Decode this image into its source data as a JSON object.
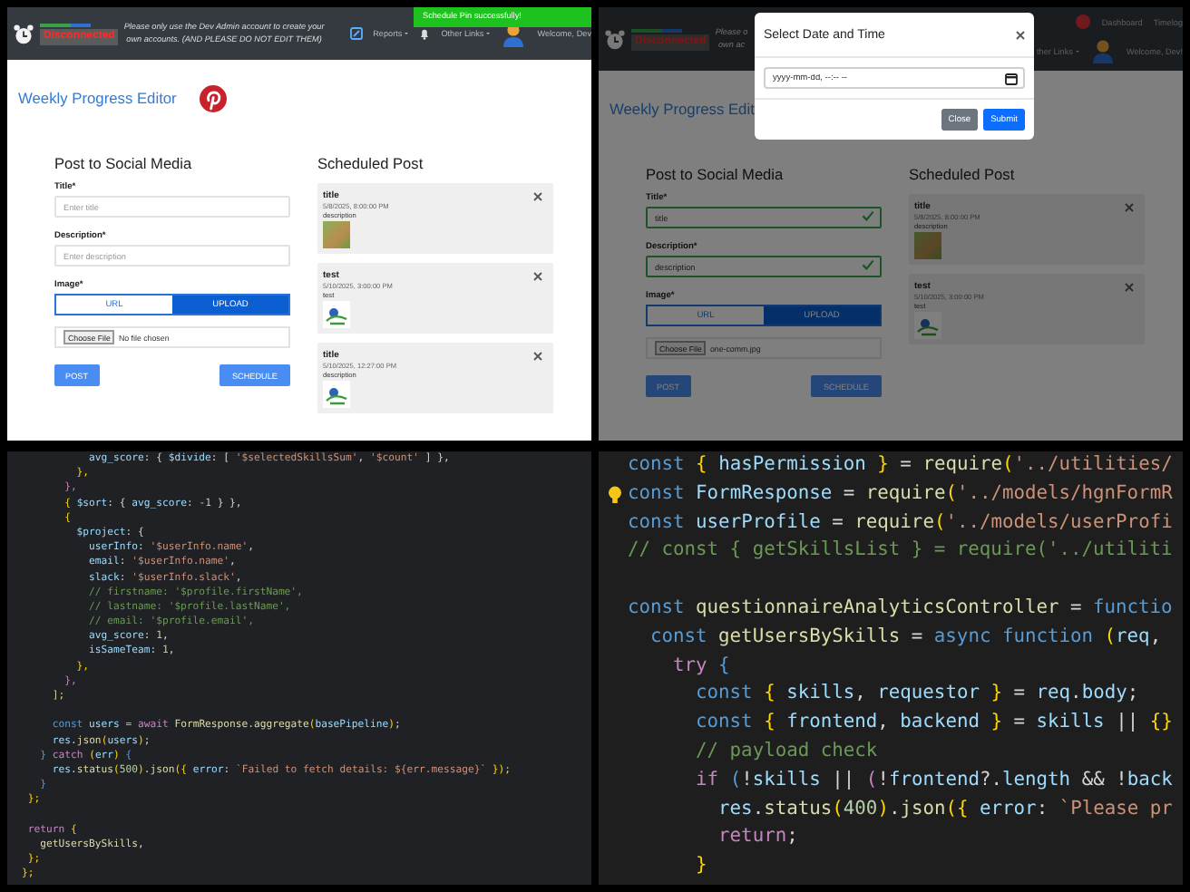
{
  "panels": [
    {
      "kind": "app",
      "header": {
        "status": "Disconnected",
        "message_lines": [
          "Please only use the Dev Admin account to create your",
          "own accounts. (AND PLEASE DO NOT EDIT THEM)"
        ],
        "toast": "Schedule Pin successfully!",
        "nav_rows": [
          [
            {
              "kind": "edit"
            },
            {
              "kind": "dropdown",
              "label": "Reports"
            },
            {
              "kind": "bell"
            },
            {
              "kind": "dropdown",
              "label": "Other Links"
            },
            {
              "kind": "avatar"
            },
            {
              "kind": "text",
              "label": "Welcome, Dev"
            }
          ]
        ]
      },
      "page_title": "Weekly Progress Editor",
      "title_icons": [
        {
          "kind": "pinterest"
        }
      ],
      "form": {
        "heading": "Post to Social Media",
        "fields": [
          {
            "label": "Title*",
            "placeholder": "Enter title",
            "valid": false
          },
          {
            "label": "Description*",
            "placeholder": "Enter description",
            "valid": false
          }
        ],
        "image": {
          "label": "Image*",
          "options": [
            {
              "label": "URL",
              "selected": false
            },
            {
              "label": "UPLOAD",
              "selected": true
            }
          ]
        },
        "file": {
          "button": "Choose File",
          "status": "No file chosen"
        },
        "buttons": [
          "POST",
          "SCHEDULE"
        ]
      },
      "scheduled": {
        "heading": "Scheduled Post",
        "posts": [
          {
            "title": "title",
            "time": "5/8/2025, 8:00:00 PM",
            "description": "description",
            "thumbnail": {
              "kind": "photo"
            }
          },
          {
            "title": "test",
            "time": "5/10/2025, 3:00:00 PM",
            "description": "test",
            "thumbnail": {
              "kind": "logo"
            }
          },
          {
            "title": "title",
            "time": "5/10/2025, 12:27:00 PM",
            "description": "description",
            "thumbnail": {
              "kind": "logo"
            }
          }
        ]
      }
    },
    {
      "kind": "app",
      "header": {
        "status": "Disconnected",
        "message_lines": [
          "Please o",
          "own ac"
        ],
        "nav_rows": [
          [
            {
              "kind": "notification"
            },
            {
              "kind": "link",
              "label": "Dashboard"
            },
            {
              "kind": "link",
              "label": "Timelog"
            }
          ],
          [
            {
              "kind": "dropdown",
              "label": "ther Links"
            },
            {
              "kind": "avatar"
            },
            {
              "kind": "text",
              "label": "Welcome, Dev!"
            }
          ]
        ]
      },
      "page_title": "Weekly Progress Edit",
      "modal": {
        "title": "Select Date and Time",
        "input_placeholder": "yyyy-mm-dd, --:-- --",
        "buttons": [
          {
            "label": "Close",
            "kind": "secondary"
          },
          {
            "label": "Submit",
            "kind": "primary"
          }
        ]
      },
      "form": {
        "heading": "Post to Social Media",
        "fields": [
          {
            "label": "Title*",
            "value": "title",
            "valid": true
          },
          {
            "label": "Description*",
            "value": "description",
            "valid": true
          }
        ],
        "image": {
          "label": "Image*",
          "options": [
            {
              "label": "URL",
              "selected": false
            },
            {
              "label": "UPLOAD",
              "selected": true
            }
          ]
        },
        "file": {
          "button": "Choose File",
          "status": "one-comm.jpg"
        },
        "buttons": [
          "POST",
          "SCHEDULE"
        ]
      },
      "scheduled": {
        "heading": "Scheduled Post",
        "posts": [
          {
            "title": "title",
            "time": "5/8/2025, 8:00:00 PM",
            "description": "description",
            "thumbnail": {
              "kind": "photo"
            }
          },
          {
            "title": "test",
            "time": "5/10/2025, 3:00:00 PM",
            "description": "test",
            "thumbnail": {
              "kind": "logo"
            }
          }
        ]
      }
    },
    {
      "kind": "code",
      "lines": [
        {
          "kind": "code",
          "segments": [
            {
              "kind": "var",
              "text": "           avg_score"
            },
            {
              "kind": "p",
              "text": ": { "
            },
            {
              "kind": "var",
              "text": "$divide"
            },
            {
              "kind": "p",
              "text": ": [ "
            },
            {
              "kind": "str",
              "text": "'$selectedSkillsSum'"
            },
            {
              "kind": "p",
              "text": ", "
            },
            {
              "kind": "str",
              "text": "'$count'"
            },
            {
              "kind": "p",
              "text": " ] },"
            }
          ]
        },
        {
          "kind": "code",
          "segments": [
            {
              "kind": "br",
              "text": "         },"
            }
          ]
        },
        {
          "kind": "code",
          "segments": [
            {
              "kind": "kw",
              "text": "       },"
            }
          ]
        },
        {
          "kind": "code",
          "segments": [
            {
              "kind": "br",
              "text": "       { "
            },
            {
              "kind": "var",
              "text": "$sort"
            },
            {
              "kind": "p",
              "text": ": { "
            },
            {
              "kind": "var",
              "text": "avg_score"
            },
            {
              "kind": "p",
              "text": ": "
            },
            {
              "kind": "num",
              "text": "-1"
            },
            {
              "kind": "p",
              "text": " } },"
            }
          ]
        },
        {
          "kind": "code",
          "segments": [
            {
              "kind": "br",
              "text": "       {"
            }
          ]
        },
        {
          "kind": "code",
          "segments": [
            {
              "kind": "var",
              "text": "         $project"
            },
            {
              "kind": "p",
              "text": ": {"
            }
          ]
        },
        {
          "kind": "code",
          "segments": [
            {
              "kind": "var",
              "text": "           userInfo"
            },
            {
              "kind": "p",
              "text": ": "
            },
            {
              "kind": "str",
              "text": "'$userInfo.name'"
            },
            {
              "kind": "p",
              "text": ","
            }
          ]
        },
        {
          "kind": "code",
          "segments": [
            {
              "kind": "var",
              "text": "           email"
            },
            {
              "kind": "p",
              "text": ": "
            },
            {
              "kind": "str",
              "text": "'$userInfo.name'"
            },
            {
              "kind": "p",
              "text": ","
            }
          ]
        },
        {
          "kind": "code",
          "segments": [
            {
              "kind": "var",
              "text": "           slack"
            },
            {
              "kind": "p",
              "text": ": "
            },
            {
              "kind": "str",
              "text": "'$userInfo.slack'"
            },
            {
              "kind": "p",
              "text": ","
            }
          ]
        },
        {
          "kind": "code",
          "segments": [
            {
              "kind": "cm",
              "text": "           // firstname: '$profile.firstName',"
            }
          ]
        },
        {
          "kind": "code",
          "segments": [
            {
              "kind": "cm",
              "text": "           // lastname: '$profile.lastName',"
            }
          ]
        },
        {
          "kind": "code",
          "segments": [
            {
              "kind": "cm",
              "text": "           // email: '$profile.email',"
            }
          ]
        },
        {
          "kind": "code",
          "segments": [
            {
              "kind": "var",
              "text": "           avg_score"
            },
            {
              "kind": "p",
              "text": ": "
            },
            {
              "kind": "num",
              "text": "1"
            },
            {
              "kind": "p",
              "text": ","
            }
          ]
        },
        {
          "kind": "code",
          "segments": [
            {
              "kind": "var",
              "text": "           isSameTeam"
            },
            {
              "kind": "p",
              "text": ": "
            },
            {
              "kind": "num",
              "text": "1"
            },
            {
              "kind": "p",
              "text": ","
            }
          ]
        },
        {
          "kind": "code",
          "segments": [
            {
              "kind": "br",
              "text": "         },"
            }
          ]
        },
        {
          "kind": "code",
          "segments": [
            {
              "kind": "kw",
              "text": "       },"
            }
          ]
        },
        {
          "kind": "code",
          "segments": [
            {
              "kind": "br",
              "text": "     ];"
            }
          ]
        },
        {
          "kind": "blank"
        },
        {
          "kind": "code",
          "segments": [
            {
              "kind": "decl",
              "text": "     const "
            },
            {
              "kind": "var",
              "text": "users"
            },
            {
              "kind": "p",
              "text": " = "
            },
            {
              "kind": "kw",
              "text": "await "
            },
            {
              "kind": "fn",
              "text": "FormResponse"
            },
            {
              "kind": "p",
              "text": "."
            },
            {
              "kind": "fn",
              "text": "aggregate"
            },
            {
              "kind": "br",
              "text": "("
            },
            {
              "kind": "var",
              "text": "basePipeline"
            },
            {
              "kind": "br",
              "text": ")"
            },
            {
              "kind": "p",
              "text": ";"
            }
          ]
        },
        {
          "kind": "code",
          "segments": [
            {
              "kind": "var",
              "text": "     res"
            },
            {
              "kind": "p",
              "text": "."
            },
            {
              "kind": "fn",
              "text": "json"
            },
            {
              "kind": "br",
              "text": "("
            },
            {
              "kind": "var",
              "text": "users"
            },
            {
              "kind": "br",
              "text": ")"
            },
            {
              "kind": "p",
              "text": ";"
            }
          ]
        },
        {
          "kind": "code",
          "segments": [
            {
              "kind": "decl",
              "text": "   } "
            },
            {
              "kind": "kw",
              "text": "catch "
            },
            {
              "kind": "br",
              "text": "("
            },
            {
              "kind": "var",
              "text": "err"
            },
            {
              "kind": "br",
              "text": ")"
            },
            {
              "kind": "decl",
              "text": " {"
            }
          ]
        },
        {
          "kind": "code",
          "segments": [
            {
              "kind": "var",
              "text": "     res"
            },
            {
              "kind": "p",
              "text": "."
            },
            {
              "kind": "fn",
              "text": "status"
            },
            {
              "kind": "br",
              "text": "("
            },
            {
              "kind": "num",
              "text": "500"
            },
            {
              "kind": "br",
              "text": ")"
            },
            {
              "kind": "p",
              "text": "."
            },
            {
              "kind": "fn",
              "text": "json"
            },
            {
              "kind": "br",
              "text": "({"
            },
            {
              "kind": "var",
              "text": " error"
            },
            {
              "kind": "p",
              "text": ": "
            },
            {
              "kind": "str",
              "text": "`Failed to fetch details: ${err.message}`"
            },
            {
              "kind": "br",
              "text": " });"
            }
          ]
        },
        {
          "kind": "code",
          "segments": [
            {
              "kind": "decl",
              "text": "   }"
            }
          ]
        },
        {
          "kind": "code",
          "segments": [
            {
              "kind": "br",
              "text": " };"
            }
          ]
        },
        {
          "kind": "blank"
        },
        {
          "kind": "code",
          "segments": [
            {
              "kind": "kw",
              "text": " return "
            },
            {
              "kind": "br",
              "text": "{"
            }
          ]
        },
        {
          "kind": "code",
          "segments": [
            {
              "kind": "fn",
              "text": "   getUsersBySkills"
            },
            {
              "kind": "p",
              "text": ","
            }
          ]
        },
        {
          "kind": "code",
          "segments": [
            {
              "kind": "br",
              "text": " };"
            }
          ]
        },
        {
          "kind": "code",
          "segments": [
            {
              "kind": "br",
              "text": "};"
            }
          ]
        }
      ]
    },
    {
      "kind": "code_zoomed",
      "lines": [
        {
          "kind": "code",
          "segments": [
            {
              "kind": "decl",
              "text": "const "
            },
            {
              "kind": "br",
              "text": "{"
            },
            {
              "kind": "var",
              "text": " hasPermission "
            },
            {
              "kind": "br",
              "text": "}"
            },
            {
              "kind": "p",
              "text": " = "
            },
            {
              "kind": "fn",
              "text": "require"
            },
            {
              "kind": "br",
              "text": "("
            },
            {
              "kind": "str",
              "text": "'../utilities/"
            }
          ]
        },
        {
          "kind": "code",
          "segments": [
            {
              "kind": "decl",
              "text": "const "
            },
            {
              "kind": "var",
              "text": "FormResponse"
            },
            {
              "kind": "p",
              "text": " = "
            },
            {
              "kind": "fn",
              "text": "require"
            },
            {
              "kind": "br",
              "text": "("
            },
            {
              "kind": "str",
              "text": "'../models/hgnFormR"
            }
          ]
        },
        {
          "kind": "code",
          "segments": [
            {
              "kind": "decl",
              "text": "const "
            },
            {
              "kind": "var",
              "text": "userProfile"
            },
            {
              "kind": "p",
              "text": " = "
            },
            {
              "kind": "fn",
              "text": "require"
            },
            {
              "kind": "br",
              "text": "("
            },
            {
              "kind": "str",
              "text": "'../models/userProfi"
            }
          ]
        },
        {
          "kind": "code",
          "segments": [
            {
              "kind": "cm",
              "text": "// const { getSkillsList } = require('../utiliti"
            }
          ]
        },
        {
          "kind": "blank"
        },
        {
          "kind": "code",
          "segments": [
            {
              "kind": "decl",
              "text": "const "
            },
            {
              "kind": "fn",
              "text": "questionnaireAnalyticsController"
            },
            {
              "kind": "p",
              "text": " = "
            },
            {
              "kind": "decl",
              "text": "functio"
            }
          ]
        },
        {
          "kind": "code",
          "segments": [
            {
              "kind": "decl",
              "text": "  const "
            },
            {
              "kind": "fn",
              "text": "getUsersBySkills"
            },
            {
              "kind": "p",
              "text": " = "
            },
            {
              "kind": "decl",
              "text": "async function "
            },
            {
              "kind": "br",
              "text": "("
            },
            {
              "kind": "var",
              "text": "req"
            },
            {
              "kind": "p",
              "text": ","
            }
          ]
        },
        {
          "kind": "code",
          "segments": [
            {
              "kind": "kw",
              "text": "    try "
            },
            {
              "kind": "decl",
              "text": "{"
            }
          ]
        },
        {
          "kind": "code",
          "segments": [
            {
              "kind": "decl",
              "text": "      const "
            },
            {
              "kind": "br",
              "text": "{"
            },
            {
              "kind": "var",
              "text": " skills"
            },
            {
              "kind": "p",
              "text": ", "
            },
            {
              "kind": "var",
              "text": "requestor "
            },
            {
              "kind": "br",
              "text": "}"
            },
            {
              "kind": "p",
              "text": " = "
            },
            {
              "kind": "var",
              "text": "req"
            },
            {
              "kind": "p",
              "text": "."
            },
            {
              "kind": "var",
              "text": "body"
            },
            {
              "kind": "p",
              "text": ";"
            }
          ]
        },
        {
          "kind": "code",
          "segments": [
            {
              "kind": "decl",
              "text": "      const "
            },
            {
              "kind": "br",
              "text": "{"
            },
            {
              "kind": "var",
              "text": " frontend"
            },
            {
              "kind": "p",
              "text": ", "
            },
            {
              "kind": "var",
              "text": "backend "
            },
            {
              "kind": "br",
              "text": "}"
            },
            {
              "kind": "p",
              "text": " = "
            },
            {
              "kind": "var",
              "text": "skills"
            },
            {
              "kind": "p",
              "text": " || "
            },
            {
              "kind": "br",
              "text": "{}"
            }
          ]
        },
        {
          "kind": "code",
          "segments": [
            {
              "kind": "cm",
              "text": "      // payload check"
            }
          ]
        },
        {
          "kind": "code",
          "segments": [
            {
              "kind": "kw",
              "text": "      if "
            },
            {
              "kind": "decl",
              "text": "("
            },
            {
              "kind": "p",
              "text": "!"
            },
            {
              "kind": "var",
              "text": "skills"
            },
            {
              "kind": "p",
              "text": " || "
            },
            {
              "kind": "kw",
              "text": "("
            },
            {
              "kind": "p",
              "text": "!"
            },
            {
              "kind": "var",
              "text": "frontend"
            },
            {
              "kind": "p",
              "text": "?."
            },
            {
              "kind": "var",
              "text": "length"
            },
            {
              "kind": "p",
              "text": " && !"
            },
            {
              "kind": "var",
              "text": "back"
            }
          ]
        },
        {
          "kind": "code",
          "segments": [
            {
              "kind": "var",
              "text": "        res"
            },
            {
              "kind": "p",
              "text": "."
            },
            {
              "kind": "fn",
              "text": "status"
            },
            {
              "kind": "br",
              "text": "("
            },
            {
              "kind": "num",
              "text": "400"
            },
            {
              "kind": "br",
              "text": ")"
            },
            {
              "kind": "p",
              "text": "."
            },
            {
              "kind": "fn",
              "text": "json"
            },
            {
              "kind": "br",
              "text": "({"
            },
            {
              "kind": "var",
              "text": " error"
            },
            {
              "kind": "p",
              "text": ": "
            },
            {
              "kind": "str",
              "text": "`Please pr"
            }
          ]
        },
        {
          "kind": "code",
          "segments": [
            {
              "kind": "kw",
              "text": "        return"
            },
            {
              "kind": "p",
              "text": ";"
            }
          ]
        },
        {
          "kind": "code",
          "segments": [
            {
              "kind": "br",
              "text": "      }"
            }
          ]
        }
      ]
    }
  ]
}
